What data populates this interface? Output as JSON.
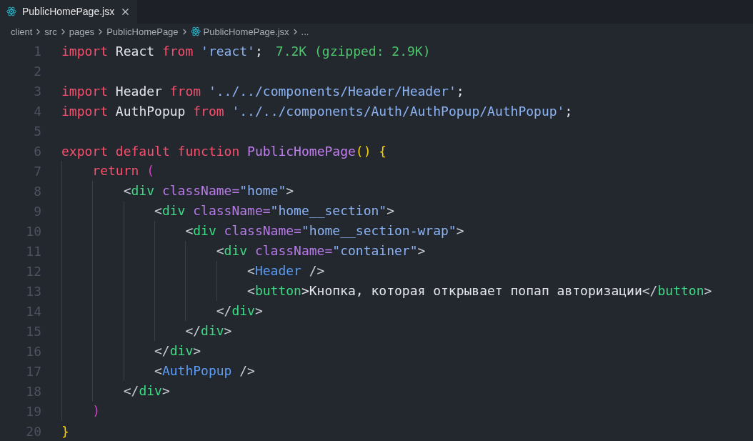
{
  "tabs": [
    {
      "label": "PublicHomePage.jsx",
      "selected": true
    }
  ],
  "breadcrumbs": [
    {
      "label": "client",
      "kind": "folder"
    },
    {
      "label": "src",
      "kind": "folder"
    },
    {
      "label": "pages",
      "kind": "folder"
    },
    {
      "label": "PublicHomePage",
      "kind": "folder"
    },
    {
      "label": "PublicHomePage.jsx",
      "kind": "react-file"
    },
    {
      "label": "...",
      "kind": "more"
    }
  ],
  "lines": [
    {
      "number": "1",
      "tokens": [
        {
          "kind": "keyword",
          "text": "import"
        },
        {
          "kind": "plain",
          "text": " React "
        },
        {
          "kind": "keyword",
          "text": "from"
        },
        {
          "kind": "string",
          "text": " 'react'"
        },
        {
          "kind": "plain",
          "text": ";"
        }
      ],
      "hint": "7.2K (gzipped: 2.9K)"
    },
    {
      "number": "2"
    },
    {
      "number": "3",
      "tokens": [
        {
          "kind": "keyword",
          "text": "import"
        },
        {
          "kind": "plain",
          "text": " Header "
        },
        {
          "kind": "keyword",
          "text": "from"
        },
        {
          "kind": "string",
          "text": " '../../components/Header/Header'"
        },
        {
          "kind": "plain",
          "text": ";"
        }
      ]
    },
    {
      "number": "4",
      "tokens": [
        {
          "kind": "keyword",
          "text": "import"
        },
        {
          "kind": "plain",
          "text": " AuthPopup "
        },
        {
          "kind": "keyword",
          "text": "from"
        },
        {
          "kind": "string",
          "text": " '../../components/Auth/AuthPopup/AuthPopup'"
        },
        {
          "kind": "plain",
          "text": ";"
        }
      ]
    },
    {
      "number": "5"
    },
    {
      "number": "6",
      "tokens": [
        {
          "kind": "keyword",
          "text": "export default function "
        },
        {
          "kind": "function",
          "text": "PublicHomePage"
        },
        {
          "kind": "bracket-yellow",
          "text": "() {"
        }
      ]
    },
    {
      "number": "7",
      "tokens": [
        {
          "kind": "keyword",
          "text": "    return "
        },
        {
          "kind": "bracket-pink",
          "text": "("
        }
      ]
    },
    {
      "number": "8",
      "tokens": [
        {
          "kind": "punct",
          "text": "        <"
        },
        {
          "kind": "tag",
          "text": "div"
        },
        {
          "kind": "attr",
          "text": " className="
        },
        {
          "kind": "string",
          "text": "\"home\""
        },
        {
          "kind": "punct",
          "text": ">"
        }
      ]
    },
    {
      "number": "9",
      "tokens": [
        {
          "kind": "punct",
          "text": "            <"
        },
        {
          "kind": "tag",
          "text": "div"
        },
        {
          "kind": "attr",
          "text": " className="
        },
        {
          "kind": "string",
          "text": "\"home__section\""
        },
        {
          "kind": "punct",
          "text": ">"
        }
      ]
    },
    {
      "number": "10",
      "tokens": [
        {
          "kind": "punct",
          "text": "                <"
        },
        {
          "kind": "tag",
          "text": "div"
        },
        {
          "kind": "attr",
          "text": " className="
        },
        {
          "kind": "string",
          "text": "\"home__section-wrap\""
        },
        {
          "kind": "punct",
          "text": ">"
        }
      ]
    },
    {
      "number": "11",
      "tokens": [
        {
          "kind": "punct",
          "text": "                    <"
        },
        {
          "kind": "tag",
          "text": "div"
        },
        {
          "kind": "attr",
          "text": " className="
        },
        {
          "kind": "string",
          "text": "\"container\""
        },
        {
          "kind": "punct",
          "text": ">"
        }
      ]
    },
    {
      "number": "12",
      "tokens": [
        {
          "kind": "punct",
          "text": "                        <"
        },
        {
          "kind": "component",
          "text": "Header"
        },
        {
          "kind": "punct",
          "text": " />"
        }
      ]
    },
    {
      "number": "13",
      "tokens": [
        {
          "kind": "punct",
          "text": "                        <"
        },
        {
          "kind": "tag",
          "text": "button"
        },
        {
          "kind": "plain",
          "text": ">Кнопка, которая открывает попап авторизации"
        },
        {
          "kind": "punct",
          "text": "</"
        },
        {
          "kind": "tag",
          "text": "button"
        },
        {
          "kind": "punct",
          "text": ">"
        }
      ]
    },
    {
      "number": "14",
      "tokens": [
        {
          "kind": "punct",
          "text": "                    </"
        },
        {
          "kind": "tag",
          "text": "div"
        },
        {
          "kind": "punct",
          "text": ">"
        }
      ]
    },
    {
      "number": "15",
      "tokens": [
        {
          "kind": "punct",
          "text": "                </"
        },
        {
          "kind": "tag",
          "text": "div"
        },
        {
          "kind": "punct",
          "text": ">"
        }
      ]
    },
    {
      "number": "16",
      "tokens": [
        {
          "kind": "punct",
          "text": "            </"
        },
        {
          "kind": "tag",
          "text": "div"
        },
        {
          "kind": "punct",
          "text": ">"
        }
      ]
    },
    {
      "number": "17",
      "tokens": [
        {
          "kind": "punct",
          "text": "            <"
        },
        {
          "kind": "component",
          "text": "AuthPopup"
        },
        {
          "kind": "punct",
          "text": " />"
        }
      ]
    },
    {
      "number": "18",
      "tokens": [
        {
          "kind": "punct",
          "text": "        </"
        },
        {
          "kind": "tag",
          "text": "div"
        },
        {
          "kind": "punct",
          "text": ">"
        }
      ]
    },
    {
      "number": "19",
      "tokens": [
        {
          "kind": "bracket-pink",
          "text": "    )"
        }
      ]
    },
    {
      "number": "20",
      "tokens": [
        {
          "kind": "bracket-yellow",
          "text": "}"
        }
      ]
    }
  ]
}
